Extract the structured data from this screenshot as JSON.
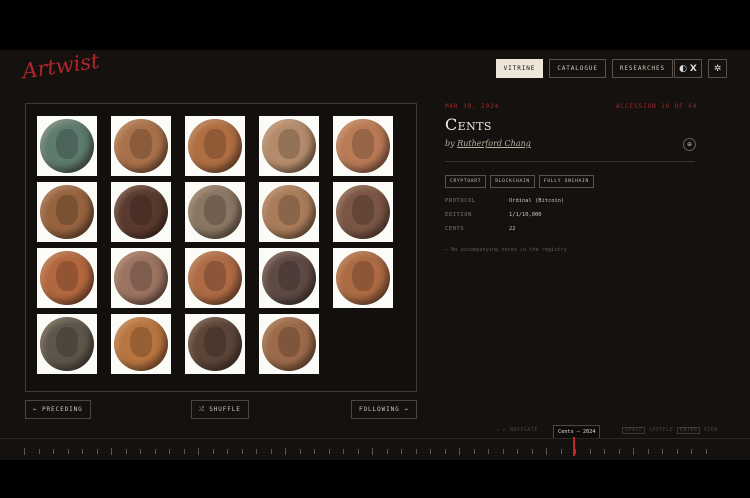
{
  "logo": {
    "text": "Artwist"
  },
  "nav": {
    "items": [
      {
        "label": "VITRINE",
        "active": true
      },
      {
        "label": "CATALOGUE",
        "active": false
      },
      {
        "label": "RESEARCHES",
        "active": false
      }
    ],
    "theme_icon": "moon-icon",
    "x_icon": "x-icon",
    "settings_icon": "gear-icon"
  },
  "artwork": {
    "date": "MAR 30, 2024",
    "accession": "ACCESSION 19 OF 64",
    "title": "Cents",
    "by": "by",
    "artist": "Rutherford Chang",
    "tags": [
      "CRYPTOART",
      "BLOCKCHAIN",
      "FULLY ONCHAIN"
    ],
    "details": [
      {
        "key": "PROTOCOL",
        "value": "Ordinal (Bitcoin)"
      },
      {
        "key": "EDITION",
        "value": "1/1/10,000"
      },
      {
        "key": "CENTS",
        "value": "22"
      }
    ],
    "note": "— No accompanying notes in the registry"
  },
  "coins": {
    "colors": [
      "#5d7b6e",
      "#a9714a",
      "#b06e43",
      "#b48b6c",
      "#b97a56",
      "#97633f",
      "#5a3a2e",
      "#8a7664",
      "#a97c5a",
      "#7b5645",
      "#b2673f",
      "#9b7361",
      "#ae6a45",
      "#5e4a44",
      "#ac6b44",
      "#5d564b",
      "#b97540",
      "#5b4438",
      "#9b6a4a"
    ]
  },
  "pager": {
    "prev": "← PRECEDING",
    "shuffle": "⤮ SHUFFLE",
    "next": "FOLLOWING →"
  },
  "timeline": {
    "current": "Cents — 2024",
    "hint_left": "◂ ▸ NAVIGATE",
    "hint_space": "SPACE",
    "hint_shuffle": "SHUFFLE",
    "hint_enter": "ENTER",
    "hint_view": "VIEW",
    "ticks": 48
  }
}
